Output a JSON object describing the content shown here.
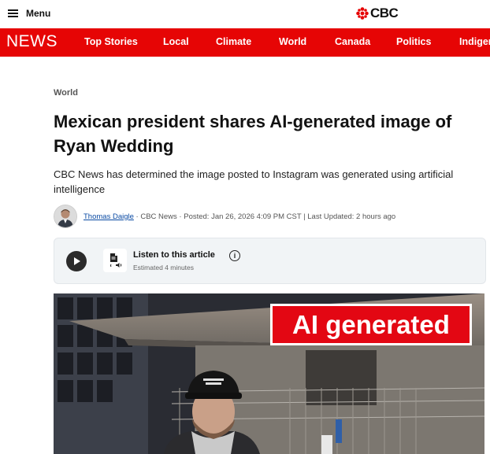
{
  "header": {
    "menu_label": "Menu",
    "logo_text": "CBC"
  },
  "nav": {
    "brand": "NEWS",
    "items": [
      "Top Stories",
      "Local",
      "Climate",
      "World",
      "Canada",
      "Politics",
      "Indigen"
    ]
  },
  "article": {
    "section": "World",
    "headline": "Mexican president shares AI-generated image of Ryan Wedding",
    "subhead": "CBC News has determined the image posted to Instagram was generated using artificial intelligence",
    "author": "Thomas Daigle",
    "byline_rest": " · CBC News · Posted: Jan 26, 2026 4:09 PM CST | Last Updated: 2 hours ago"
  },
  "listen": {
    "title": "Listen to this article",
    "info": "i",
    "estimate": "Estimated 4 minutes"
  },
  "hero": {
    "badge": "AI generated"
  },
  "colors": {
    "brand_red": "#e60505",
    "link_blue": "#0a4aa3",
    "badge_red": "#e30713"
  }
}
